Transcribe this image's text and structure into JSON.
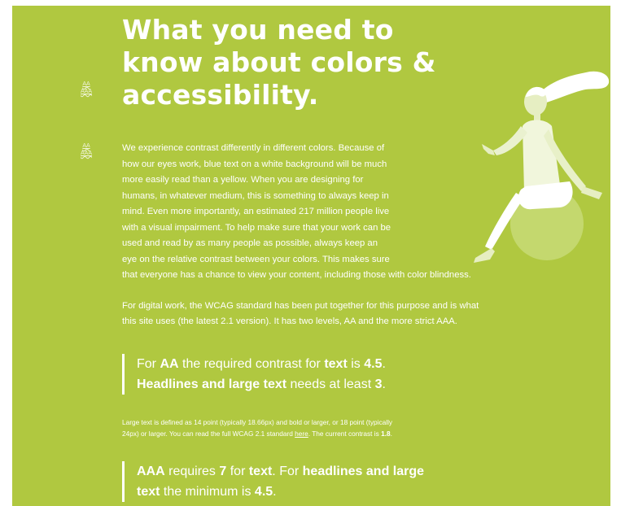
{
  "page": {
    "accent_color": "#b0c840",
    "text_color": "#ffffff"
  },
  "side_markers": [
    {
      "aa": "AA",
      "aaa": "AAA"
    },
    {
      "aa": "AA",
      "aaa": "AAA"
    }
  ],
  "headline": {
    "lines": [
      "What you need to",
      "know about colors &",
      "accessibility."
    ]
  },
  "intro": {
    "paragraph1_lines": [
      "We experience contrast differently in different colors. Because of",
      "how our eyes work, blue text on a white background will be much",
      "more easily read than a yellow. When you are designing for",
      "humans, in whatever medium, this is something to always keep in",
      "mind. Even more importantly, an estimated 217 million people live",
      "with a visual impairment. To help make sure that your work can be",
      "used and read by as many people as possible, always keep an",
      "eye on the relative contrast between your colors. This makes sure",
      "that everyone has a chance to view your content, including those with color blindness."
    ],
    "paragraph2_lines": [
      "For digital work, the WCAG standard has been put together for this purpose and is what",
      "this site uses (the latest 2.1 version). It has two levels, AA and the more strict AAA."
    ]
  },
  "callout_aa": {
    "t1": "For ",
    "b1": "AA",
    "t2": " the required contrast for ",
    "b2": "text",
    "t3": " is ",
    "b3": "4.5",
    "t4": ".",
    "b4": "Headlines and large text",
    "t5": " needs at least ",
    "b5": "3",
    "t6": "."
  },
  "note": {
    "t1": "Large text is defined as 14 point (typically 18.66px) and bold or larger, or 18 point (typically",
    "t2": "24px) or larger. You can read the full WCAG 2.1 standard ",
    "link": "here",
    "t3": ". The current contrast is ",
    "value": "1.8",
    "t4": "."
  },
  "callout_aaa": {
    "b1": "AAA",
    "t1": " requires ",
    "b2": "7",
    "t2": " for ",
    "b3": "text",
    "t3": ". For ",
    "b4": "headlines and large",
    "b5": "text",
    "t4": " the minimum is ",
    "b6": "4.5",
    "t5": "."
  },
  "illustration": {
    "icon": "person-sitting-on-ball-illustration"
  }
}
